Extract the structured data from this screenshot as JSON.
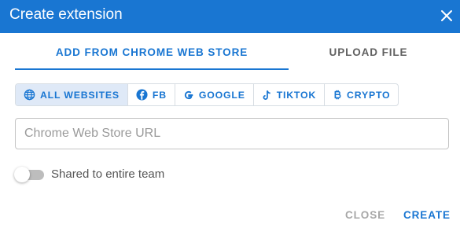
{
  "dialog": {
    "title": "Create extension",
    "close_icon": "close-icon"
  },
  "tabs": [
    {
      "label": "ADD FROM CHROME WEB STORE",
      "active": true
    },
    {
      "label": "UPLOAD FILE",
      "active": false
    }
  ],
  "filters": [
    {
      "label": "ALL WEBSITES",
      "icon": "globe-icon",
      "selected": true
    },
    {
      "label": "FB",
      "icon": "facebook-icon",
      "selected": false
    },
    {
      "label": "GOOGLE",
      "icon": "google-icon",
      "selected": false
    },
    {
      "label": "TIKTOK",
      "icon": "tiktok-icon",
      "selected": false
    },
    {
      "label": "CRYPTO",
      "icon": "bitcoin-icon",
      "selected": false
    }
  ],
  "url_input": {
    "placeholder": "Chrome Web Store URL",
    "value": ""
  },
  "shared_toggle": {
    "label": "Shared to entire team",
    "on": false
  },
  "actions": {
    "close_label": "CLOSE",
    "create_label": "CREATE"
  },
  "colors": {
    "primary": "#1976d2",
    "chip_selected_bg": "#dfe9f7",
    "muted": "#a7a7a7"
  }
}
